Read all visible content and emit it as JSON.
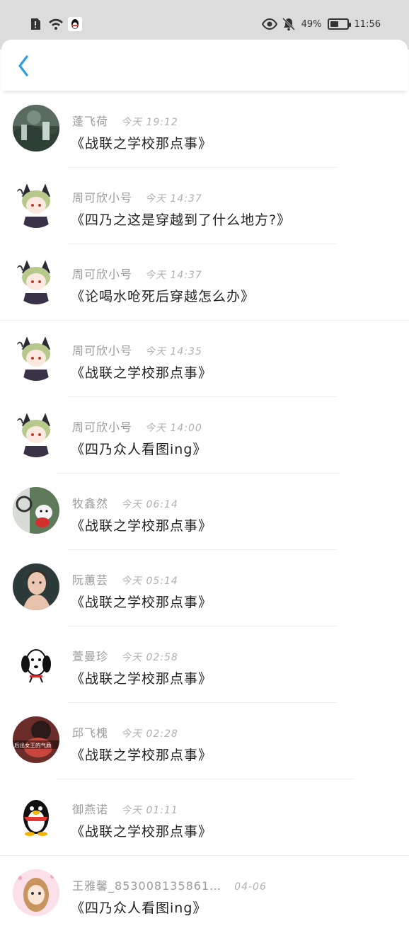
{
  "status": {
    "battery": "49%",
    "battery_level": 0.49,
    "time": "11:56"
  },
  "colors": {
    "accent": "#2a9ee0",
    "name": "#9a9a9a",
    "message": "#222222"
  },
  "items": [
    {
      "name": "蓬飞荷",
      "time": "今天 19:12",
      "message": "《战联之学校那点事》",
      "avatar": "forest-photo"
    },
    {
      "name": "周可欣小号",
      "time": "今天 14:37",
      "message": "《四乃之这是穿越到了什么地方?》",
      "avatar": "anime-catboy"
    },
    {
      "name": "周可欣小号",
      "time": "今天 14:37",
      "message": "《论喝水呛死后穿越怎么办》",
      "avatar": "anime-catboy"
    },
    {
      "name": "周可欣小号",
      "time": "今天 14:35",
      "message": "《战联之学校那点事》",
      "avatar": "anime-catboy"
    },
    {
      "name": "周可欣小号",
      "time": "今天 14:00",
      "message": "《四乃众人看图ing》",
      "avatar": "anime-catboy"
    },
    {
      "name": "牧鑫然",
      "time": "今天 06:14",
      "message": "《战联之学校那点事》",
      "avatar": "dog-plush"
    },
    {
      "name": "阮蕙芸",
      "time": "今天 05:14",
      "message": "《战联之学校那点事》",
      "avatar": "woman-portrait"
    },
    {
      "name": "萱曼珍",
      "time": "今天 02:58",
      "message": "《战联之学校那点事》",
      "avatar": "snoopy"
    },
    {
      "name": "邱飞槐",
      "time": "今天 02:28",
      "message": "《战联之学校那点事》",
      "avatar": "queen-photo"
    },
    {
      "name": "御燕诺",
      "time": "今天 01:11",
      "message": "《战联之学校那点事》",
      "avatar": "qq-penguin"
    },
    {
      "name": "王雅馨_853008135861…",
      "time": "04-06",
      "message": "《四乃众人看图ing》",
      "avatar": "girl-cartoon"
    }
  ],
  "queen_photo_text": "后出女王的气质"
}
